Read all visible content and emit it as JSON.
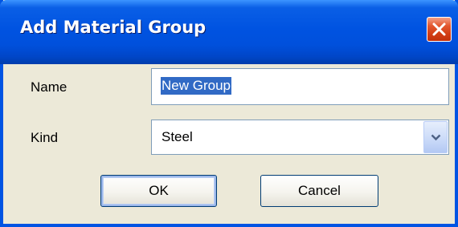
{
  "dialog": {
    "title": "Add Material Group",
    "close_icon": "close-icon",
    "colors": {
      "titlebar": "#0054e3",
      "close_button": "#d5431b",
      "body": "#ece9d8",
      "selection": "#316ac5",
      "field_border": "#7f9db9"
    }
  },
  "form": {
    "name_label": "Name",
    "name_value": "New Group",
    "kind_label": "Kind",
    "kind_value": "Steel",
    "kind_dropdown_icon": "chevron-down-icon"
  },
  "buttons": {
    "ok_label": "OK",
    "cancel_label": "Cancel"
  }
}
